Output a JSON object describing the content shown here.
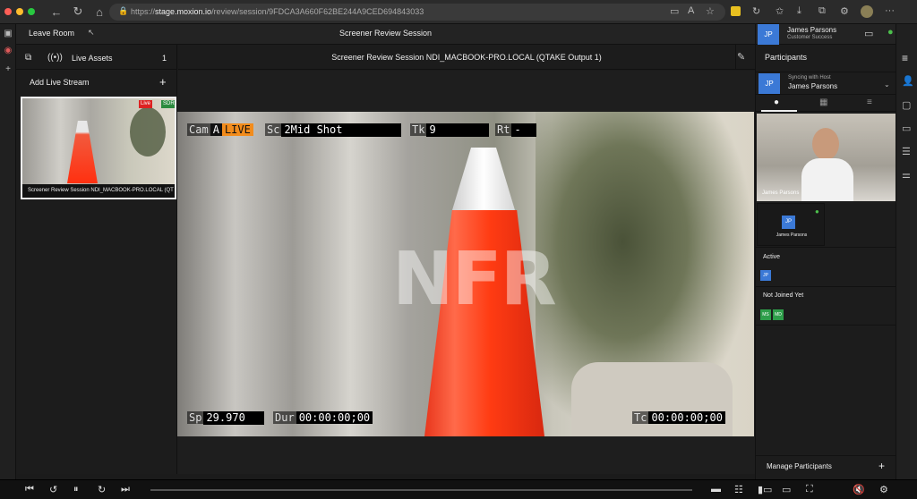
{
  "browser": {
    "url_prefix": "https://",
    "url_host": "stage.moxion.io",
    "url_path": "/review/session/9FDCA3A660F62BE244A9CED694843033"
  },
  "header": {
    "leave_room": "Leave Room",
    "session_title": "Screener Review Session"
  },
  "left_panel": {
    "live_assets_label": "Live Assets",
    "live_assets_count": "1",
    "add_stream_label": "Add Live Stream",
    "thumb_caption": "Screener Review Session NDI_MACBOOK-PRO.LOCAL (QT",
    "thumb_live_badge": "Live",
    "thumb_sdr_badge": "SDR"
  },
  "stream": {
    "title": "Screener Review Session NDI_MACBOOK-PRO.LOCAL (QTAKE Output 1)",
    "watermark": "NFR",
    "slate": {
      "cam_label": "Cam",
      "cam_value": "A",
      "live": "LIVE",
      "sc_label": "Sc",
      "sc_value": "2Mid Shot",
      "tk_label": "Tk",
      "tk_value": "9",
      "rt_label": "Rt",
      "rt_value": "-",
      "sp_label": "Sp",
      "sp_value": "29.970",
      "dur_label": "Dur",
      "dur_value": "00:00:00;00",
      "tc_label": "Tc",
      "tc_value": "00:00:00;00"
    }
  },
  "right_panel": {
    "user": {
      "initials": "JP",
      "name": "James Parsons",
      "role": "Customer Success"
    },
    "participants_title": "Participants",
    "sync_label": "Syncing with Host",
    "sync_name": "James Parsons",
    "video_name": "James Parsons",
    "tile_initials": "JP",
    "tile_name": "James Parsons",
    "active_label": "Active",
    "active_initials": "JP",
    "not_joined_label": "Not Joined Yet",
    "not_joined": [
      "MS",
      "MD"
    ],
    "manage_label": "Manage Participants"
  },
  "colors": {
    "accent_blue": "#3b79d6",
    "live_orange": "#f28c1c",
    "green_avatar": "#2e9e4a"
  }
}
